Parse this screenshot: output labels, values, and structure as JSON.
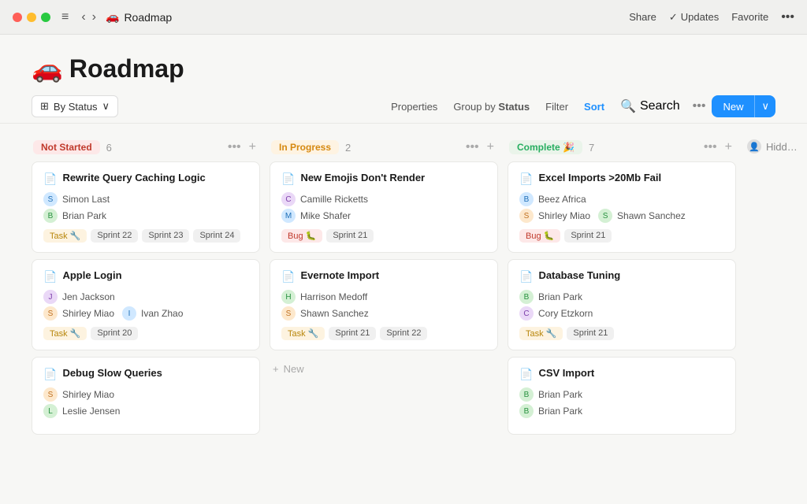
{
  "titlebar": {
    "title": "Roadmap",
    "emoji": "🚗",
    "actions": {
      "share": "Share",
      "updates": "Updates",
      "favorite": "Favorite"
    }
  },
  "page": {
    "title": "Roadmap",
    "emoji": "🚗"
  },
  "toolbar": {
    "view_btn": "By Status",
    "properties": "Properties",
    "group_by": "Group by",
    "group_by_value": "Status",
    "filter": "Filter",
    "sort": "Sort",
    "search": "Search",
    "new": "New"
  },
  "columns": [
    {
      "id": "not-started",
      "label": "Not Started",
      "count": 6,
      "status_class": "status-not-started",
      "cards": [
        {
          "title": "Rewrite Query Caching Logic",
          "assignees": [
            {
              "name": "Simon Last",
              "color": "blue"
            },
            {
              "name": "Brian Park",
              "color": "green"
            }
          ],
          "tags": [
            {
              "label": "Task 🔧",
              "class": "tag-task"
            }
          ],
          "sprints": [
            "Sprint 22",
            "Sprint 23",
            "Sprint 24"
          ]
        },
        {
          "title": "Apple Login",
          "assignees": [
            {
              "name": "Jen Jackson",
              "color": "purple"
            },
            {
              "name": "Shirley Miao",
              "color": "orange"
            },
            {
              "name": "Ivan Zhao",
              "color": "blue"
            }
          ],
          "tags": [
            {
              "label": "Task 🔧",
              "class": "tag-task"
            }
          ],
          "sprints": [
            "Sprint 20"
          ]
        },
        {
          "title": "Debug Slow Queries",
          "assignees": [
            {
              "name": "Shirley Miao",
              "color": "orange"
            },
            {
              "name": "Leslie Jensen",
              "color": "green"
            }
          ],
          "tags": [],
          "sprints": []
        }
      ]
    },
    {
      "id": "in-progress",
      "label": "In Progress",
      "count": 2,
      "status_class": "status-in-progress",
      "cards": [
        {
          "title": "New Emojis Don't Render",
          "assignees": [
            {
              "name": "Camille Ricketts",
              "color": "purple"
            },
            {
              "name": "Mike Shafer",
              "color": "blue"
            }
          ],
          "tags": [
            {
              "label": "Bug 🐛",
              "class": "tag-bug"
            }
          ],
          "sprints": [
            "Sprint 21"
          ]
        },
        {
          "title": "Evernote Import",
          "assignees": [
            {
              "name": "Harrison Medoff",
              "color": "green"
            },
            {
              "name": "Shawn Sanchez",
              "color": "orange"
            }
          ],
          "tags": [
            {
              "label": "Task 🔧",
              "class": "tag-task"
            }
          ],
          "sprints": [
            "Sprint 21",
            "Sprint 22"
          ]
        }
      ],
      "show_new": true
    },
    {
      "id": "complete",
      "label": "Complete 🎉",
      "count": 7,
      "status_class": "status-complete",
      "cards": [
        {
          "title": "Excel Imports >20Mb Fail",
          "assignees": [
            {
              "name": "Beez Africa",
              "color": "blue"
            },
            {
              "name": "Shirley Miao",
              "color": "orange"
            },
            {
              "name": "Shawn Sanchez",
              "color": "green"
            }
          ],
          "tags": [
            {
              "label": "Bug 🐛",
              "class": "tag-bug"
            }
          ],
          "sprints": [
            "Sprint 21"
          ]
        },
        {
          "title": "Database Tuning",
          "assignees": [
            {
              "name": "Brian Park",
              "color": "green"
            },
            {
              "name": "Cory Etzkorn",
              "color": "purple"
            }
          ],
          "tags": [
            {
              "label": "Task 🔧",
              "class": "tag-task"
            }
          ],
          "sprints": [
            "Sprint 21"
          ]
        },
        {
          "title": "CSV Import",
          "assignees": [
            {
              "name": "Brian Park",
              "color": "green"
            },
            {
              "name": "Brian Park",
              "color": "green"
            }
          ],
          "tags": [],
          "sprints": []
        }
      ]
    },
    {
      "id": "hidden",
      "label": "Hidd…",
      "count": null,
      "status_class": "status-hidden"
    }
  ]
}
